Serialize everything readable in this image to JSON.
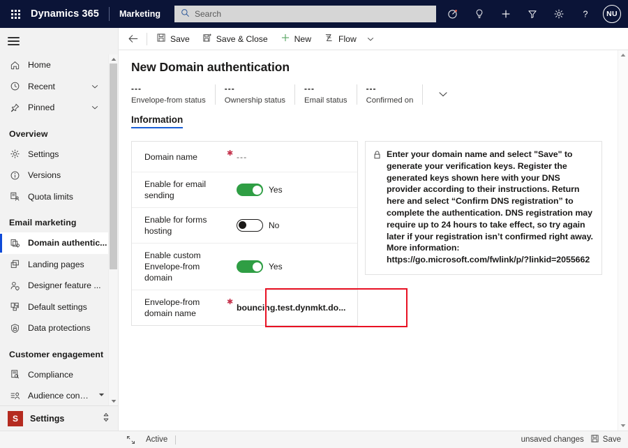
{
  "topbar": {
    "waffle_label": "App launcher",
    "brand": "Dynamics 365",
    "app_name": "Marketing",
    "search_placeholder": "Search",
    "search_value": "",
    "icons": [
      {
        "name": "performance-icon",
        "label": "Performance"
      },
      {
        "name": "lightbulb-icon",
        "label": "Ideas"
      },
      {
        "name": "plus-icon",
        "label": "Quick create"
      },
      {
        "name": "filter-icon",
        "label": "Filter"
      },
      {
        "name": "gear-icon",
        "label": "Settings"
      },
      {
        "name": "help-icon",
        "label": "Help"
      }
    ],
    "avatar_initials": "NU"
  },
  "sidebar": {
    "hamburger_label": "Expand navigation",
    "items": [
      {
        "label": "Home",
        "icon": "home-icon",
        "expandable": false,
        "active": false
      },
      {
        "label": "Recent",
        "icon": "clock-icon",
        "expandable": true,
        "active": false
      },
      {
        "label": "Pinned",
        "icon": "pin-icon",
        "expandable": true,
        "active": false
      }
    ],
    "groups": [
      {
        "title": "Overview",
        "items": [
          {
            "label": "Settings",
            "icon": "gear-icon",
            "active": false
          },
          {
            "label": "Versions",
            "icon": "info-icon",
            "active": false
          },
          {
            "label": "Quota limits",
            "icon": "quota-icon",
            "active": false
          }
        ]
      },
      {
        "title": "Email marketing",
        "items": [
          {
            "label": "Domain authentic...",
            "icon": "domain-auth-icon",
            "active": true
          },
          {
            "label": "Landing pages",
            "icon": "pages-icon",
            "active": false
          },
          {
            "label": "Designer feature ...",
            "icon": "designer-icon",
            "active": false
          },
          {
            "label": "Default settings",
            "icon": "default-settings-icon",
            "active": false
          },
          {
            "label": "Data protections",
            "icon": "shield-icon",
            "active": false
          }
        ]
      },
      {
        "title": "Customer engagement",
        "items": [
          {
            "label": "Compliance",
            "icon": "compliance-icon",
            "active": false
          },
          {
            "label": "Audience configur...",
            "icon": "audience-icon",
            "active": false
          }
        ]
      }
    ],
    "footer": {
      "badge": "S",
      "label": "Settings",
      "chevron": "area-switcher-icon"
    }
  },
  "commandbar": {
    "back_label": "Back",
    "buttons": [
      {
        "label": "Save",
        "icon": "save-icon"
      },
      {
        "label": "Save & Close",
        "icon": "save-close-icon"
      },
      {
        "label": "New",
        "icon": "plus-icon"
      },
      {
        "label": "Flow",
        "icon": "flow-icon",
        "has_chevron": true
      }
    ]
  },
  "page": {
    "title": "New Domain authentication",
    "bpf_stages": [
      {
        "value": "---",
        "label": "Envelope-from status"
      },
      {
        "value": "---",
        "label": "Ownership status"
      },
      {
        "value": "---",
        "label": "Email status"
      },
      {
        "value": "---",
        "label": "Confirmed on"
      }
    ],
    "bpf_chevron": "chevron-down-icon",
    "tabs": [
      {
        "label": "Information",
        "selected": true
      }
    ]
  },
  "form": {
    "fields": [
      {
        "label": "Domain name",
        "required": true,
        "type": "text",
        "value": "---"
      },
      {
        "label": "Enable for email sending",
        "required": false,
        "type": "toggle",
        "toggle_on": true,
        "value": "Yes"
      },
      {
        "label": "Enable for forms hosting",
        "required": false,
        "type": "toggle",
        "toggle_on": false,
        "value": "No"
      },
      {
        "label": "Enable custom Envelope-from domain",
        "required": false,
        "type": "toggle",
        "toggle_on": true,
        "value": "Yes",
        "highlighted": true
      },
      {
        "label": "Envelope-from domain name",
        "required": true,
        "type": "text-bold",
        "value": "bouncing.test.dynmkt.do..."
      }
    ]
  },
  "infopane": {
    "icon": "lock-icon",
    "text": "Enter your domain name and select \"Save\" to generate your verification keys. Register the generated keys shown here with your DNS provider according to their instructions. Return here and select “Confirm DNS registration” to complete the authentication. DNS registration may require up to 24 hours to take effect, so try again later if your registration isn’t confirmed right away. More information: https://go.microsoft.com/fwlink/p/?linkid=2055662"
  },
  "statusbar": {
    "expand_icon": "expand-icon",
    "state": "Active",
    "unsaved": "unsaved changes",
    "save_label": "Save",
    "save_icon": "save-icon"
  },
  "colors": {
    "topbar_bg": "#0b1437",
    "accent_blue": "#1a5fd6",
    "toggle_on_green": "#2f9e44",
    "required_red": "#c4314b",
    "highlight_red": "#e81123",
    "settings_badge_red": "#b52b20"
  }
}
